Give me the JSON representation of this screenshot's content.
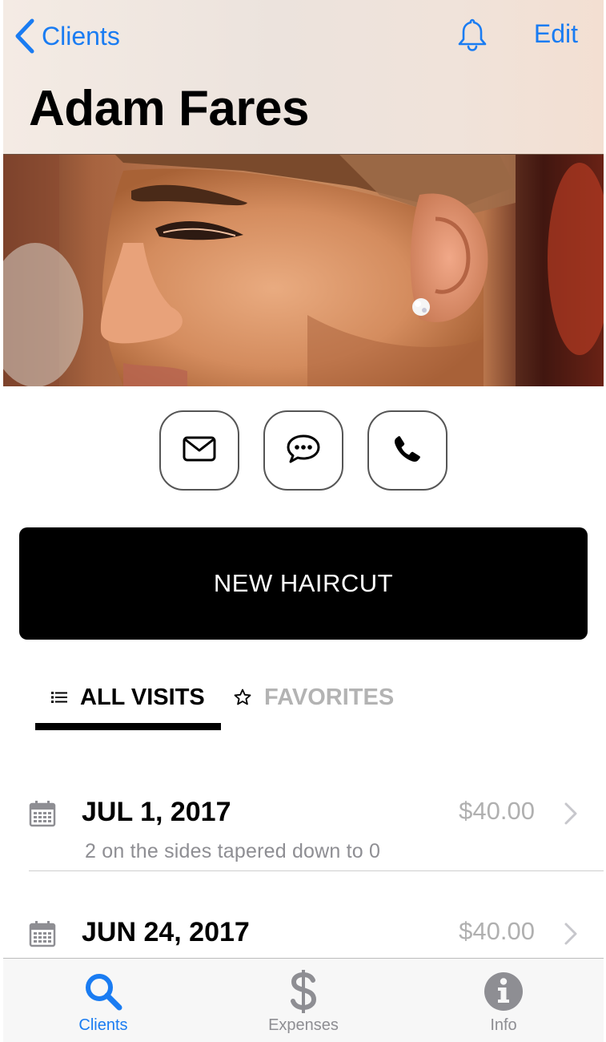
{
  "nav": {
    "back_label": "Clients",
    "edit_label": "Edit",
    "back_icon": "chevron-left-icon",
    "bell_icon": "bell-icon"
  },
  "client": {
    "name": "Adam Fares"
  },
  "contact_actions": [
    {
      "icon": "envelope-icon",
      "action": "email"
    },
    {
      "icon": "chat-bubble-icon",
      "action": "message"
    },
    {
      "icon": "phone-icon",
      "action": "call"
    }
  ],
  "new_haircut_label": "NEW HAIRCUT",
  "tabs": [
    {
      "label": "ALL VISITS",
      "icon": "list-icon",
      "active": true
    },
    {
      "label": "FAVORITES",
      "icon": "star-icon",
      "active": false
    }
  ],
  "visits": [
    {
      "date": "JUL 1, 2017",
      "price": "$40.00",
      "note": "2 on the sides tapered down to 0"
    },
    {
      "date": "JUN 24, 2017",
      "price": "$40.00",
      "note": ""
    }
  ],
  "tabbar": [
    {
      "label": "Clients",
      "icon": "search-icon",
      "active": true
    },
    {
      "label": "Expenses",
      "icon": "dollar-icon",
      "active": false
    },
    {
      "label": "Info",
      "icon": "info-icon",
      "active": false
    }
  ],
  "colors": {
    "accent": "#1a7cf2",
    "inactive": "#8e8e93",
    "price": "#b0b0b0",
    "button_bg": "#000000"
  }
}
